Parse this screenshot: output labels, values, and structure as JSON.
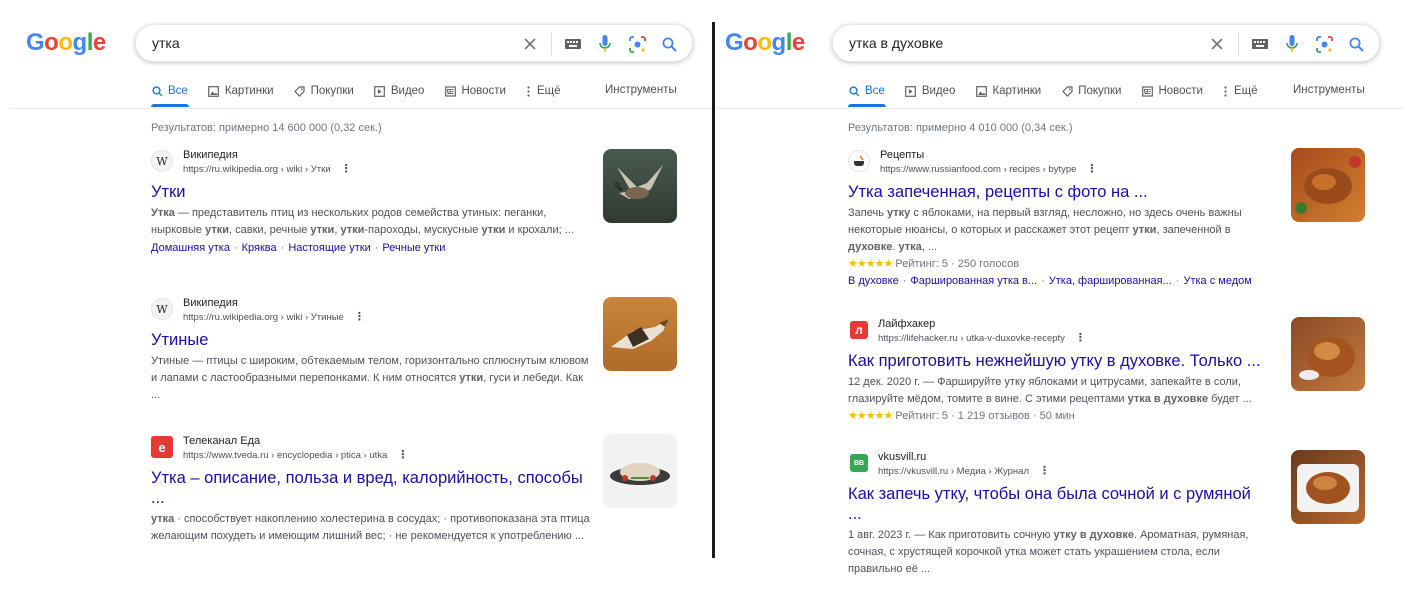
{
  "left": {
    "logo": [
      "G",
      "o",
      "o",
      "g",
      "l",
      "e"
    ],
    "query": "утка",
    "tabs": [
      "Все",
      "Картинки",
      "Покупки",
      "Видео",
      "Новости",
      "Ещё"
    ],
    "tools_label": "Инструменты",
    "stats": "Результатов: примерно 14 600 000 (0,32 сек.)",
    "results": [
      {
        "site": "Википедия",
        "url": "https://ru.wikipedia.org › wiki › Утки",
        "favicon": "W",
        "title": "Утки",
        "snippet_parts": [
          "Утка",
          " — представитель птиц из нескольких родов семейства утиных: пеганки, нырковые ",
          "утки",
          ", савки, речные ",
          "утки",
          ", ",
          "утки",
          "-пароходы, мускусные ",
          "утки",
          " и крохали; ..."
        ],
        "sublinks": [
          "Домашняя утка",
          "Кряква",
          "Настоящие утки",
          "Речные утки"
        ]
      },
      {
        "site": "Википедия",
        "url": "https://ru.wikipedia.org › wiki › Утиные",
        "favicon": "W",
        "title": "Утиные",
        "snippet_parts": [
          "Утиные — птицы с широким, обтекаемым телом, горизонтально сплюснутым клювом и лапами с ластообразными перепонками. К ним относятся ",
          "утки",
          ", гуси и лебеди. Как ..."
        ]
      },
      {
        "site": "Телеканал Еда",
        "url": "https://www.tveda.ru › encyclopedia › ptica › utka",
        "favicon": "e",
        "title": "Утка – описание, польза и вред, калорийность, способы ...",
        "snippet_parts": [
          "утка",
          " · способствует накоплению холестерина в сосудах; · противопоказана эта птица желающим похудеть и имеющим лишний вес; · не рекомендуется к употреблению ..."
        ]
      }
    ]
  },
  "right": {
    "logo": [
      "G",
      "o",
      "o",
      "g",
      "l",
      "e"
    ],
    "query": "утка в духовке",
    "tabs": [
      "Все",
      "Видео",
      "Картинки",
      "Покупки",
      "Новости",
      "Ещё"
    ],
    "tools_label": "Инструменты",
    "stats": "Результатов: примерно 4 010 000 (0,34 сек.)",
    "results": [
      {
        "site": "Рецепты",
        "url": "https://www.russianfood.com › recipes › bytype",
        "title": "Утка запеченная, рецепты с фото на ...",
        "snippet_parts": [
          "Запечь ",
          "утку",
          " с яблоками, на первый взгляд, несложно, но здесь очень важны некоторые нюансы, о которых и расскажет этот рецепт ",
          "утки",
          ", запеченной в ",
          "духовке",
          ". ",
          "утка",
          ", ..."
        ],
        "stars": "★★★★★",
        "rating": "Рейтинг: 5 · 250 голосов",
        "sublinks": [
          "В духовке",
          "Фаршированная утка в...",
          "Утка, фаршированная...",
          "Утка с медом"
        ]
      },
      {
        "site": "Лайфхакер",
        "url": "https://lifehacker.ru › utka-v-duxovke-recepty",
        "favicon": "л",
        "title": "Как приготовить нежнейшую утку в духовке. Только ...",
        "snippet_parts": [
          "12 дек. 2020 г. — Фаршируйте утку яблоками и цитрусами, запекайте в соли, глазируйте мёдом, томите в вине. С этими рецептами ",
          "утка в духовке",
          " будет ..."
        ],
        "stars": "★★★★★",
        "rating": "Рейтинг: 5 · 1 219 отзывов · 50 мин"
      },
      {
        "site": "vkusvill.ru",
        "url": "https://vkusvill.ru › Медиа › Журнал",
        "favicon": "ВВ",
        "title": "Как запечь утку, чтобы она была сочной и с румяной ...",
        "snippet_parts": [
          "1 авг. 2023 г. — Как приготовить сочную ",
          "утку в духовке",
          ". Ароматная, румяная, сочная, с хрустящей корочкой утка может стать украшением стола, если правильно её ..."
        ]
      }
    ]
  },
  "colors": {
    "link": "#1a0dab",
    "accent": "#1a73e8",
    "star": "#fbbc04"
  }
}
